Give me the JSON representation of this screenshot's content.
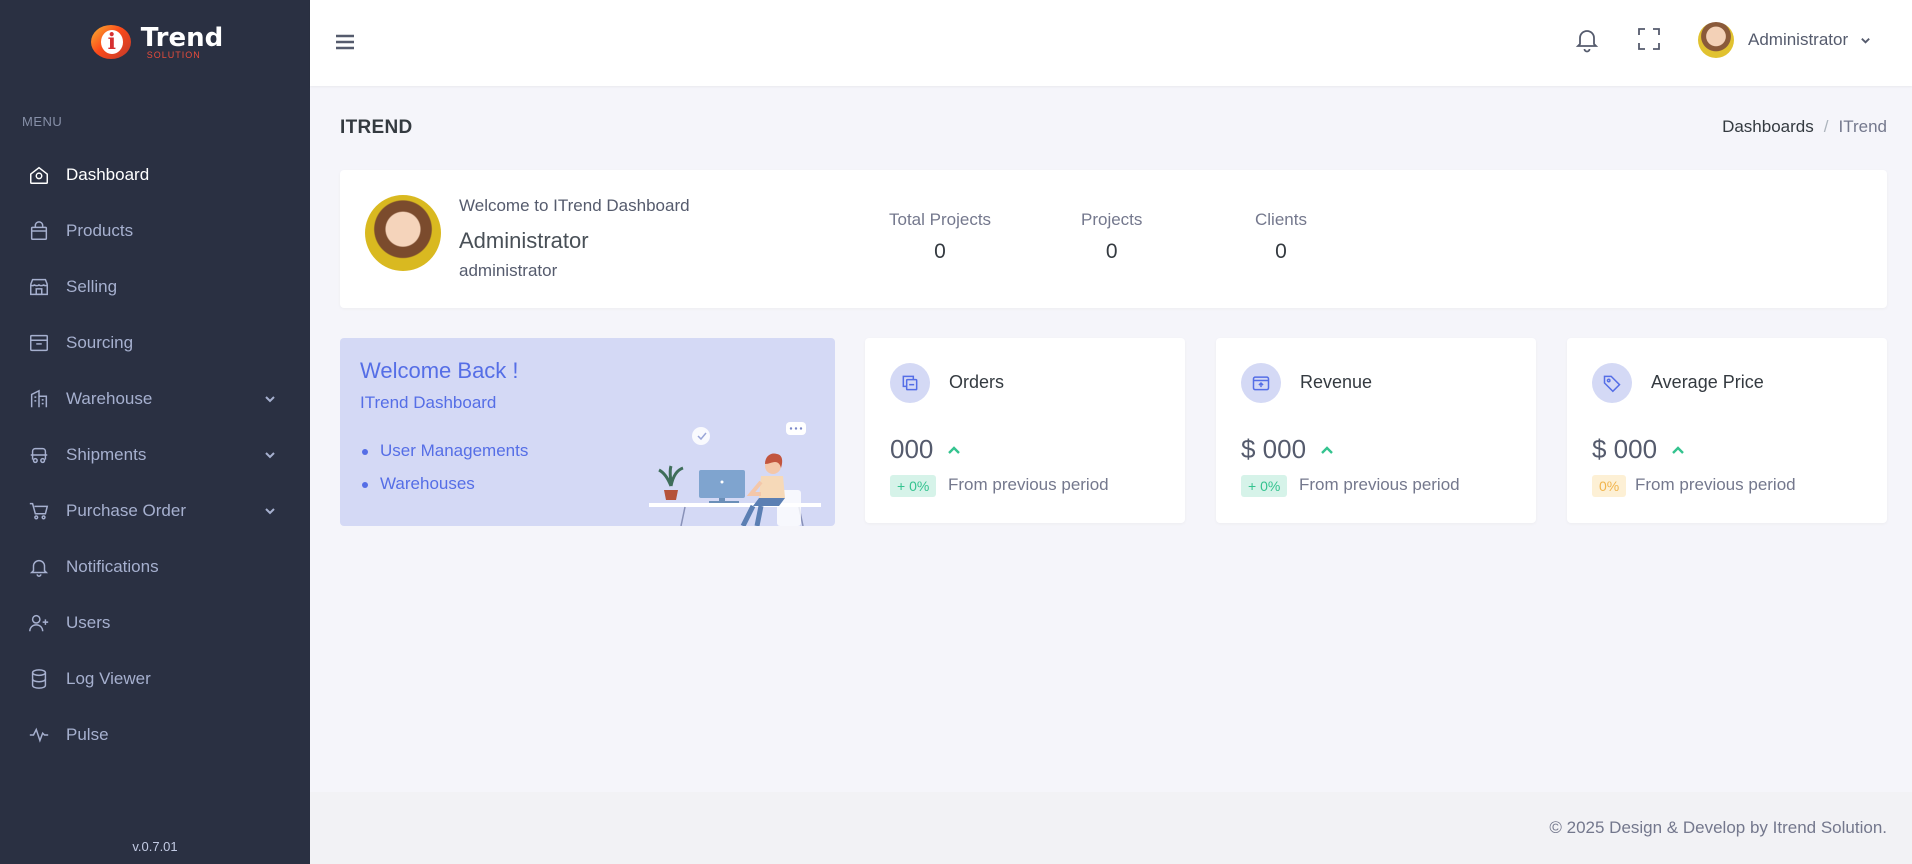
{
  "sidebar": {
    "logo_word": "Trend",
    "logo_sub": "SOLUTION",
    "menu_title": "MENU",
    "items": [
      {
        "label": "Dashboard",
        "icon": "home-icon"
      },
      {
        "label": "Products",
        "icon": "bag-icon"
      },
      {
        "label": "Selling",
        "icon": "store-icon"
      },
      {
        "label": "Sourcing",
        "icon": "archive-icon"
      },
      {
        "label": "Warehouse",
        "icon": "building-icon"
      },
      {
        "label": "Shipments",
        "icon": "truck-icon"
      },
      {
        "label": "Purchase Order",
        "icon": "cart-icon"
      },
      {
        "label": "Notifications",
        "icon": "bell-icon"
      },
      {
        "label": "Users",
        "icon": "user-plus-icon"
      },
      {
        "label": "Log Viewer",
        "icon": "database-icon"
      },
      {
        "label": "Pulse",
        "icon": "pulse-icon"
      }
    ],
    "version": "v.0.7.01"
  },
  "topbar": {
    "user_name": "Administrator"
  },
  "page": {
    "title": "ITREND",
    "breadcrumb": [
      "Dashboards",
      "ITrend"
    ]
  },
  "profile": {
    "welcome": "Welcome to ITrend Dashboard",
    "name": "Administrator",
    "role": "administrator",
    "stats": [
      {
        "label": "Total Projects",
        "value": "0"
      },
      {
        "label": "Projects",
        "value": "0"
      },
      {
        "label": "Clients",
        "value": "0"
      }
    ]
  },
  "welcome_card": {
    "title": "Welcome Back !",
    "subtitle": "ITrend Dashboard",
    "links": [
      "User Managements",
      "Warehouses"
    ]
  },
  "kpis": [
    {
      "title": "Orders",
      "value": "000",
      "badge": "+ 0%",
      "badge_color": "#34c38f",
      "foot": "From previous period"
    },
    {
      "title": "Revenue",
      "value": "$ 000",
      "badge": "+ 0%",
      "badge_color": "#34c38f",
      "foot": "From previous period"
    },
    {
      "title": "Average Price",
      "value": "$ 000",
      "badge": "0%",
      "badge_color": "#f1b44c",
      "foot": "From previous period"
    }
  ],
  "footer": {
    "text": "© 2025 Design & Develop by Itrend Solution."
  },
  "colors": {
    "sidebar_bg": "#2a3042",
    "accent": "#556ee6",
    "success": "#34c38f",
    "warning": "#f1b44c"
  }
}
